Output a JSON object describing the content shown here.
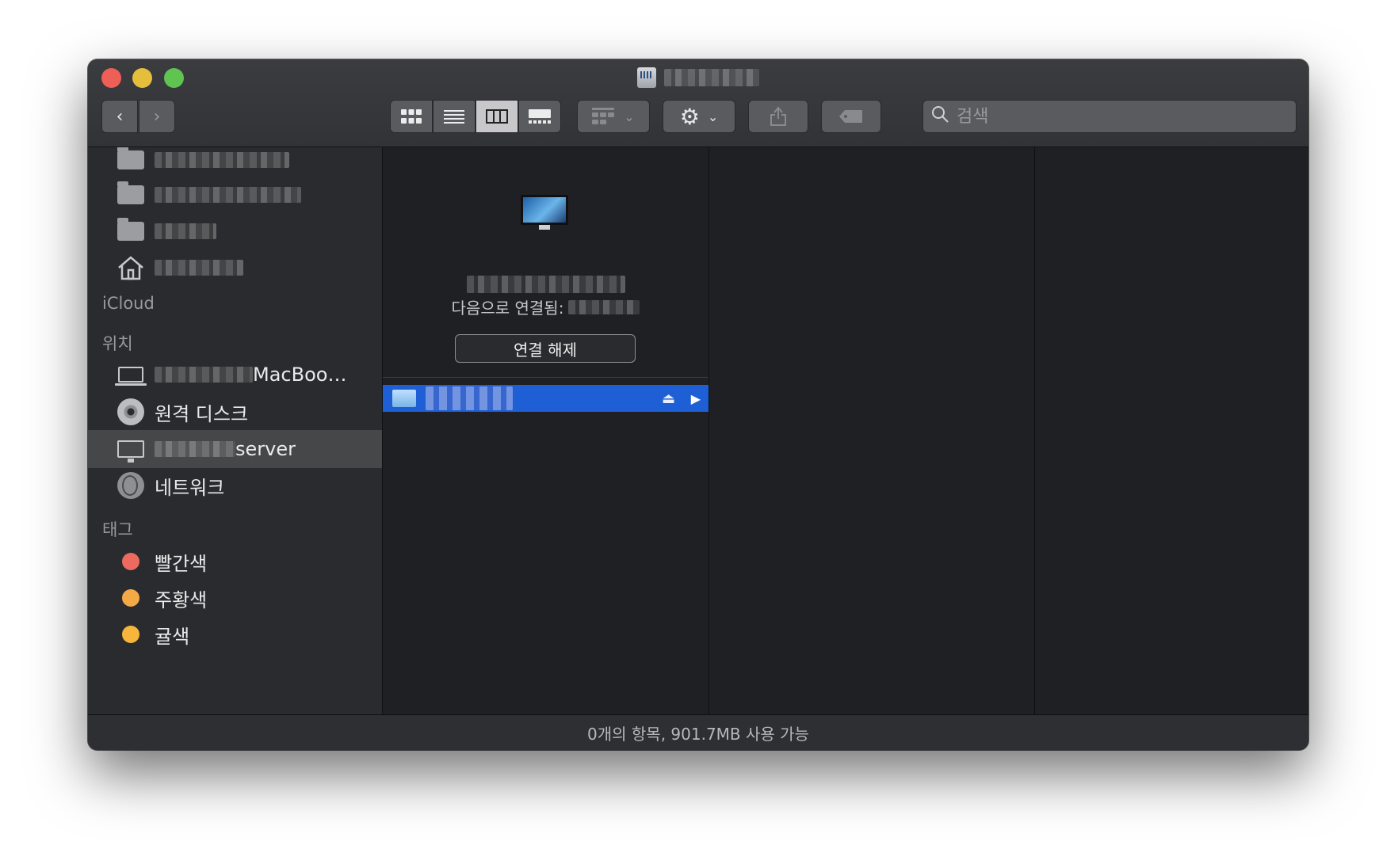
{
  "window": {
    "title_icon": "server-volume-icon"
  },
  "toolbar": {
    "back_icon": "‹",
    "forward_icon": "›",
    "view_icons": [
      "icon-view",
      "list-view",
      "column-view",
      "gallery-view"
    ],
    "search_placeholder": "검색"
  },
  "sidebar": {
    "sections": {
      "icloud": "iCloud",
      "locations": "위치",
      "tags": "태그"
    },
    "locations": [
      {
        "label": "MacBoo…",
        "icon": "laptop-icon"
      },
      {
        "label": "원격 디스크",
        "icon": "disc-icon"
      },
      {
        "label": "server",
        "icon": "monitor-icon",
        "selected": true
      },
      {
        "label": "네트워크",
        "icon": "globe-icon"
      }
    ],
    "tags": [
      {
        "label": "빨간색",
        "color": "#ec6a5e"
      },
      {
        "label": "주황색",
        "color": "#f4a947"
      },
      {
        "label": "귤색",
        "color": "#f6b63c"
      }
    ]
  },
  "server_panel": {
    "connected_label": "다음으로 연결됨:",
    "disconnect_label": "연결 해제"
  },
  "status": {
    "text": "0개의 항목, 901.7MB 사용 가능"
  }
}
